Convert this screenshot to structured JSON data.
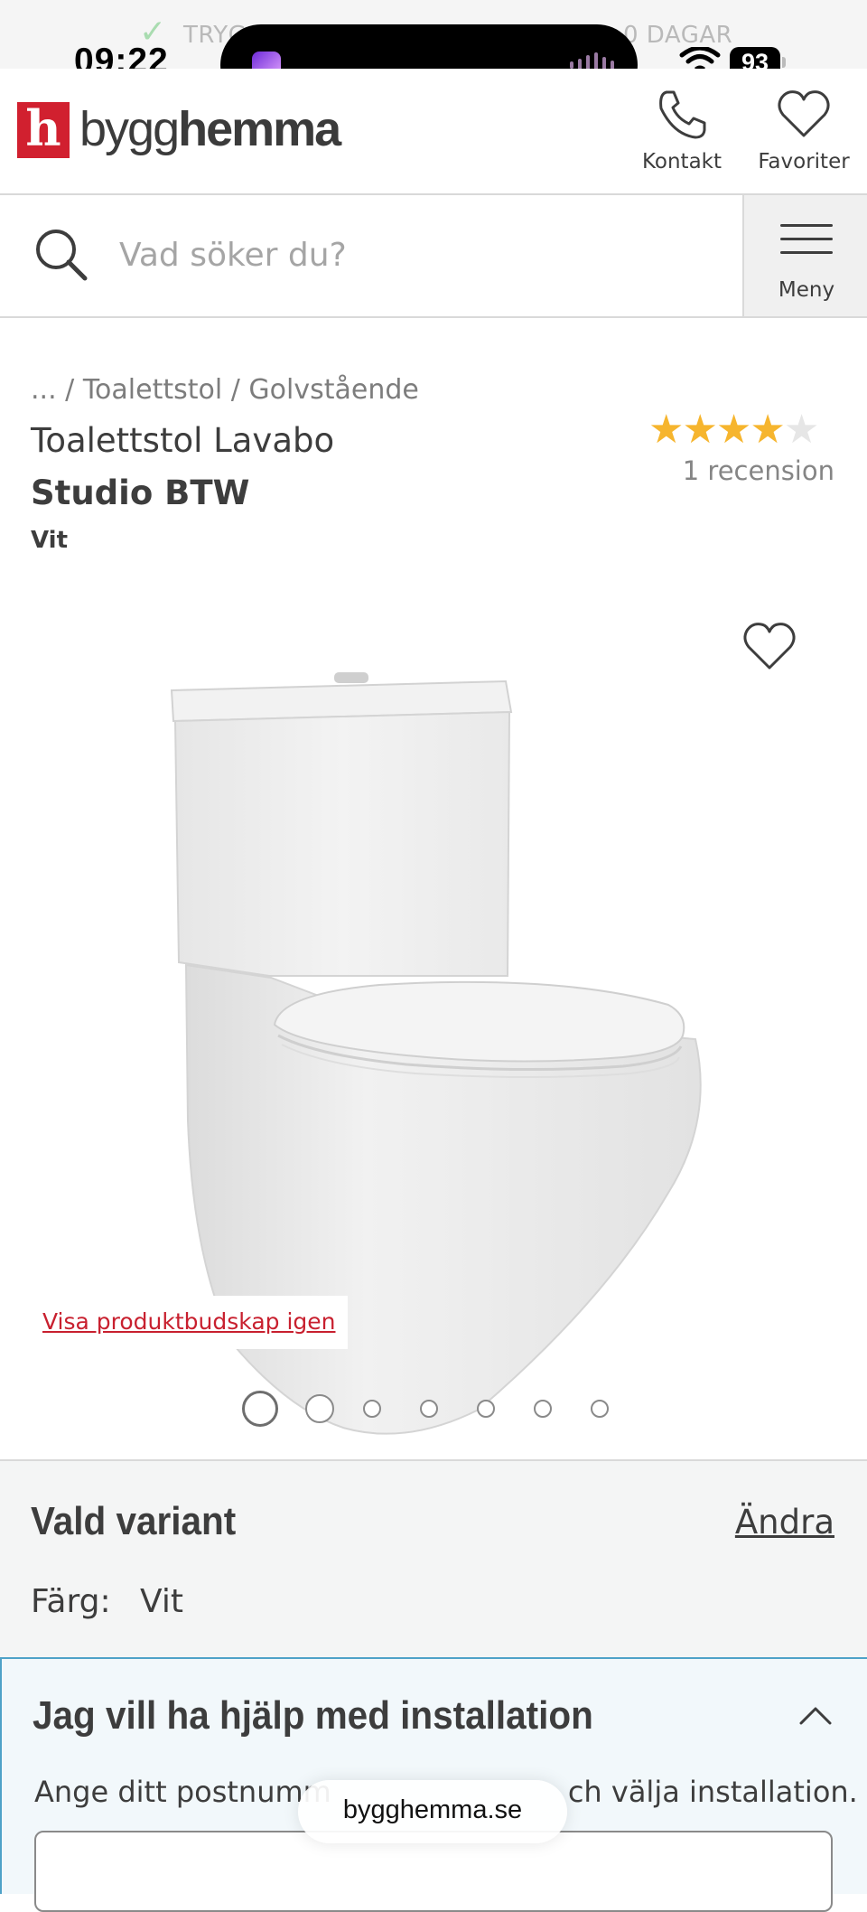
{
  "status_bar": {
    "time": "09:22",
    "battery": "93"
  },
  "promo": {
    "text_left": "TRYG",
    "text_right": "0 DAGAR"
  },
  "header": {
    "logo_letter": "h",
    "logo_name_light": "bygg",
    "logo_name_bold": "hemma",
    "contact_label": "Kontakt",
    "favorites_label": "Favoriter"
  },
  "search": {
    "placeholder": "Vad söker du?",
    "menu_label": "Meny"
  },
  "breadcrumb": {
    "ellipsis": "...",
    "sep": "/",
    "level1": "Toalettstol",
    "level2": "Golvstående"
  },
  "product": {
    "name": "Toalettstol Lavabo",
    "brand": "Studio BTW",
    "color": "Vit",
    "rating": 4,
    "rating_max": 5,
    "reviews": "1 recension"
  },
  "gallery": {
    "show_message_link": "Visa produktbudskap igen",
    "image_count": 7,
    "active_index": 0
  },
  "variant": {
    "title": "Vald variant",
    "change_label": "Ändra",
    "color_label": "Färg:",
    "color_value": "Vit"
  },
  "installation": {
    "title": "Jag vill ha hjälp med installation",
    "description_start": "Ange ditt postnumm",
    "description_end": "ch välja installation."
  },
  "browser": {
    "url": "bygghemma.se"
  },
  "colors": {
    "brand_red": "#d1202f",
    "star": "#f6b52e",
    "install_border": "#4fa2c8"
  }
}
